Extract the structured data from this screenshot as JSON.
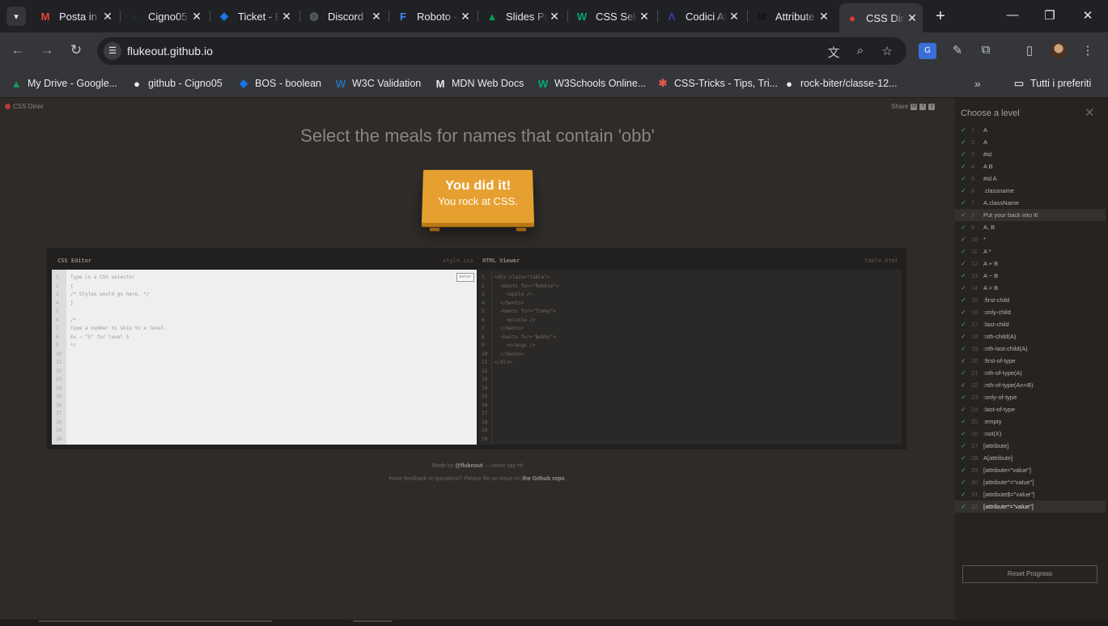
{
  "browser": {
    "tabs": [
      {
        "label": "Posta in arrivo",
        "icon": "gmail-icon",
        "color": "#ea4335",
        "glyph": "M"
      },
      {
        "label": "Cigno05",
        "icon": "github-icon",
        "color": "#24292f",
        "glyph": "●"
      },
      {
        "label": "Ticket - Boolean",
        "icon": "boolean-icon",
        "color": "#1a73e8",
        "glyph": "◆"
      },
      {
        "label": "Discord",
        "icon": "globe-icon",
        "color": "#5f6368",
        "glyph": "◍"
      },
      {
        "label": "Roboto - Google Fonts",
        "icon": "google-fonts-icon",
        "color": "#4285f4",
        "glyph": "F"
      },
      {
        "label": "Slides Presentazione",
        "icon": "google-drive-icon",
        "color": "#0f9d58",
        "glyph": "▲"
      },
      {
        "label": "CSS Selectors",
        "icon": "w3schools-icon",
        "color": "#04aa6d",
        "glyph": "W"
      },
      {
        "label": "Codici Attributi",
        "icon": "codici-icon",
        "color": "#3b3bb8",
        "glyph": "Λ"
      },
      {
        "label": "Attribute selectors",
        "icon": "mdn-icon",
        "color": "#111111",
        "glyph": "M"
      },
      {
        "label": "CSS Diner",
        "icon": "css-diner-icon",
        "color": "#e53935",
        "glyph": "●"
      }
    ],
    "url": "flukeout.github.io",
    "bookmarks": [
      {
        "label": "My Drive - Google...",
        "icon": "google-drive-icon",
        "color": "#0f9d58",
        "glyph": "▲"
      },
      {
        "label": "github - Cigno05",
        "icon": "github-icon",
        "color": "#e8eaed",
        "glyph": "●"
      },
      {
        "label": "BOS - boolean",
        "icon": "boolean-icon",
        "color": "#1a73e8",
        "glyph": "◆"
      },
      {
        "label": "W3C Validation",
        "icon": "w3c-icon",
        "color": "#2a6db3",
        "glyph": "W"
      },
      {
        "label": "MDN Web Docs",
        "icon": "mdn-icon",
        "color": "#e8eaed",
        "glyph": "M"
      },
      {
        "label": "W3Schools Online...",
        "icon": "w3schools-icon",
        "color": "#04aa6d",
        "glyph": "W"
      },
      {
        "label": "CSS-Tricks - Tips, Tri...",
        "icon": "css-tricks-icon",
        "color": "#e2574c",
        "glyph": "✱"
      },
      {
        "label": "rock-biter/classe-12...",
        "icon": "github-icon",
        "color": "#e8eaed",
        "glyph": "●"
      }
    ],
    "all_bookmarks": "Tutti i preferiti"
  },
  "page": {
    "logo": "CSS Diner",
    "share": "Share",
    "order": "Select the meals for names that contain 'obb'",
    "win_title": "You did it!",
    "win_subtitle": "You rock at CSS.",
    "css_editor": {
      "title": "CSS Editor",
      "file": "style.css",
      "enter": "enter",
      "line_numbers": [
        "1",
        "2",
        "3",
        "4",
        "5",
        "6",
        "7",
        "8",
        "9",
        "10",
        "11",
        "12",
        "13",
        "14",
        "15",
        "16",
        "17",
        "18",
        "19",
        "20"
      ],
      "lines": [
        "Type in a CSS selector",
        "{",
        "/* Styles would go here. */",
        "}",
        "",
        "/*",
        "Type a number to skip to a level.",
        "Ex → \"5\" for level 5",
        "*/"
      ]
    },
    "html_viewer": {
      "title": "HTML Viewer",
      "file": "table.html",
      "line_numbers": [
        "1",
        "2",
        "3",
        "4",
        "5",
        "6",
        "7",
        "8",
        "9",
        "10",
        "11",
        "12",
        "13",
        "14",
        "15",
        "16",
        "17",
        "18",
        "19",
        "20"
      ],
      "lines": [
        "<div class=\"table\">",
        "  <bento for=\"Robbie\">",
        "    <apple />",
        "  </bento>",
        "  <bento for=\"Timmy\">",
        "    <pickle />",
        "  </bento>",
        "  <bento for=\"Bobby\">",
        "    <orange />",
        "  </bento>",
        "</div>"
      ]
    },
    "footer": {
      "made_by_prefix": "Made by",
      "author": "@flukeout",
      "made_by_suffix": "— come say hi!",
      "feedback_prefix": "Have feedback or questions? Please file an issue on",
      "repo": "the Github repo",
      "feedback_suffix": "."
    }
  },
  "levels": {
    "title": "Choose a level",
    "reset": "Reset Progress",
    "items": [
      {
        "num": "1",
        "name": "A"
      },
      {
        "num": "2",
        "name": "A"
      },
      {
        "num": "3",
        "name": "#id"
      },
      {
        "num": "4",
        "name": "A B"
      },
      {
        "num": "5",
        "name": "#id A"
      },
      {
        "num": "6",
        "name": ".classname"
      },
      {
        "num": "7",
        "name": "A.className"
      },
      {
        "num": "8",
        "name": "Put your back into it!"
      },
      {
        "num": "9",
        "name": "A, B"
      },
      {
        "num": "10",
        "name": "*"
      },
      {
        "num": "11",
        "name": "A *"
      },
      {
        "num": "12",
        "name": "A + B"
      },
      {
        "num": "13",
        "name": "A ~ B"
      },
      {
        "num": "14",
        "name": "A > B"
      },
      {
        "num": "15",
        "name": ":first-child"
      },
      {
        "num": "16",
        "name": ":only-child"
      },
      {
        "num": "17",
        "name": ":last-child"
      },
      {
        "num": "18",
        "name": ":nth-child(A)"
      },
      {
        "num": "19",
        "name": ":nth-last-child(A)"
      },
      {
        "num": "20",
        "name": ":first-of-type"
      },
      {
        "num": "21",
        "name": ":nth-of-type(A)"
      },
      {
        "num": "22",
        "name": ":nth-of-type(An+B)"
      },
      {
        "num": "23",
        "name": ":only-of-type"
      },
      {
        "num": "24",
        "name": ":last-of-type"
      },
      {
        "num": "25",
        "name": ":empty"
      },
      {
        "num": "26",
        "name": ":not(X)"
      },
      {
        "num": "27",
        "name": "[attribute]"
      },
      {
        "num": "28",
        "name": "A[attribute]"
      },
      {
        "num": "29",
        "name": "[attribute=\"value\"]"
      },
      {
        "num": "30",
        "name": "[attribute^=\"value\"]"
      },
      {
        "num": "31",
        "name": "[attribute$=\"value\"]"
      },
      {
        "num": "32",
        "name": "[attribute*=\"value\"]"
      }
    ]
  }
}
